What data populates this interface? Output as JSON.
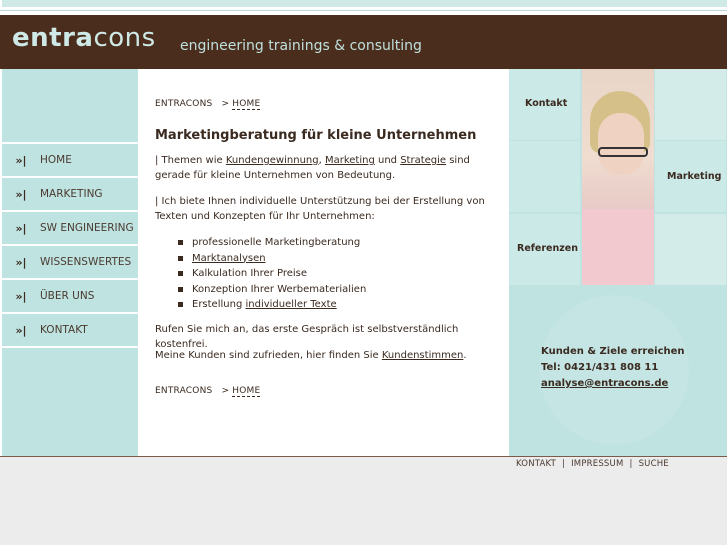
{
  "header": {
    "logo_bold": "entra",
    "logo_light": "cons",
    "tagline": "engineering trainings & consulting"
  },
  "sidebar": {
    "arrow": "»|",
    "items": [
      {
        "label": "HOME"
      },
      {
        "label": "MARKETING"
      },
      {
        "label": "SW ENGINEERING"
      },
      {
        "label": "WISSENSWERTES"
      },
      {
        "label": "ÜBER UNS"
      },
      {
        "label": "KONTAKT"
      }
    ]
  },
  "breadcrumb": {
    "root": "ENTRACONS",
    "sep": ">",
    "home": "HOME"
  },
  "content": {
    "title": "Marketingberatung für kleine Unternehmen",
    "p1_a": "| Themen wie ",
    "p1_link1": "Kundengewinnung",
    "p1_b": ", ",
    "p1_link2": "Marketing",
    "p1_c": " und ",
    "p1_link3": "Strategie",
    "p1_d": " sind gerade für kleine Unternehmen von Bedeutung.",
    "p2": "| Ich biete Ihnen individuelle Unterstützung bei der Erstellung von Texten und Konzepten für Ihr Unternehmen:",
    "bullets": {
      "b1": "professionelle Marketingberatung",
      "b2": "Marktanalysen",
      "b3": "Kalkulation Ihrer Preise",
      "b4": "Konzeption Ihrer Werbematerialien",
      "b5_a": "Erstellung ",
      "b5_link": "individueller Texte"
    },
    "p3": "Rufen Sie mich an, das erste Gespräch ist selbstverständlich kostenfrei.",
    "p4_a": "Meine Kunden sind zufrieden, hier finden Sie ",
    "p4_link": "Kundenstimmen",
    "p4_b": "."
  },
  "right_panel": {
    "tile_kontakt": "Kontakt",
    "tile_marketing": "Marketing",
    "tile_referenzen": "Referenzen",
    "contact_line1": "Kunden & Ziele erreichen",
    "contact_line2": "Tel: 0421/431 808 11",
    "contact_email": "analyse@entracons.de"
  },
  "footer": {
    "kontakt": "KONTAKT",
    "impressum": "IMPRESSUM",
    "suche": "SUCHE",
    "sep": "|"
  },
  "colors": {
    "header_bg": "#4a2d1c",
    "mint": "#bfe3e1",
    "text": "#3a2a20"
  }
}
